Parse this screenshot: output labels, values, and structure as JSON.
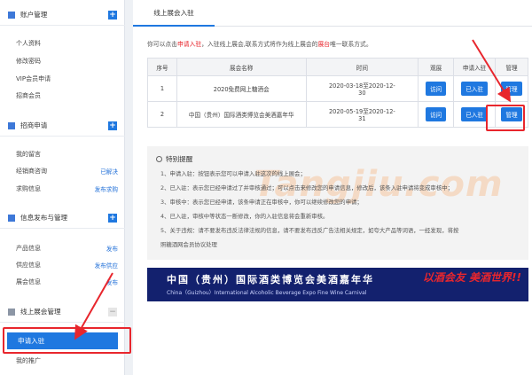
{
  "sidebar": {
    "sections": [
      {
        "title": "账户管理",
        "items": [
          {
            "label": "个人资料",
            "tag": ""
          },
          {
            "label": "修改密码",
            "tag": ""
          },
          {
            "label": "VIP会员申请",
            "tag": ""
          },
          {
            "label": "招商会员",
            "tag": ""
          }
        ]
      },
      {
        "title": "招商申请",
        "items": [
          {
            "label": "我的留言",
            "tag": ""
          },
          {
            "label": "经销商咨询",
            "tag": "已解决"
          },
          {
            "label": "求购信息",
            "tag": "发布求购"
          }
        ]
      },
      {
        "title": "信息发布与管理",
        "items": [
          {
            "label": "产品信息",
            "tag": "发布"
          },
          {
            "label": "供应信息",
            "tag": "发布供应"
          },
          {
            "label": "展会信息",
            "tag": "发布"
          }
        ]
      },
      {
        "title": "线上展会管理",
        "items": [
          {
            "label": "申请入驻",
            "tag": ""
          },
          {
            "label": "我的推广",
            "tag": ""
          }
        ]
      }
    ],
    "plus": "+",
    "minus": "−"
  },
  "main": {
    "tab": "线上展会入驻",
    "intro_a": "你可以点击",
    "intro_hl1": "申请入驻",
    "intro_b": "，入驻线上展会,联系方式将作为线上展会的",
    "intro_hl2": "展台",
    "intro_c": "唯一联系方式。",
    "table": {
      "headers": [
        "序号",
        "展会名称",
        "时间",
        "观展",
        "申请入驻",
        "管理"
      ],
      "rows": [
        {
          "no": "1",
          "name": "2020免费网上糖酒会",
          "time1": "2020-03-18至2020-12-",
          "time2": "30",
          "view": "访问",
          "apply": "已入驻",
          "manage": "管理"
        },
        {
          "no": "2",
          "name": "中国（贵州）国际酒类博览会美酒嘉年华",
          "time1": "2020-05-19至2020-12-",
          "time2": "31",
          "view": "访问",
          "apply": "已入驻",
          "manage": "管理"
        }
      ]
    },
    "notice": {
      "title": "特别提醒",
      "lines": [
        "1、申请入驻：按钮表示您可以申请入驻这次的线上展会；",
        "2、已入驻：表示您已经申请过了并审核通过；可以点击来修改您的申请信息，修改后，该条入驻申请将变成审核中；",
        "3、审核中：表示您已经申请，该条申请正在审核中，你可以继续修改您的申请；",
        "4、已入驻，审核中等状态一断修改，你的入驻信息将会重新审核。",
        "5、关于违规：请不要发布违反法律法规的信息，请不要发布违反广告法相关规定，如夸大产品等词语，一经发现，将按",
        "照糖酒网会员协议处理"
      ],
      "watermark": "Tangjiu.com"
    },
    "banner": {
      "title": "中国（贵州）国际酒类博览会美酒嘉年华",
      "subtitle": "China（Guizhou）International Alcoholic Beverage Expo Fine Wine Carnival",
      "art": "以酒会友 美酒世界!!"
    }
  }
}
